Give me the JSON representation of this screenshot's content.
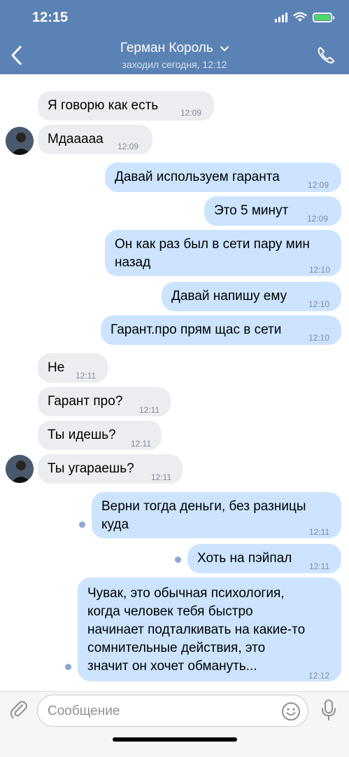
{
  "status": {
    "time": "12:15"
  },
  "header": {
    "name": "Герман Король",
    "last_seen": "заходил сегодня, 12:12"
  },
  "messages": [
    {
      "dir": "in",
      "text": "Я говорю как есть",
      "time": "12:09"
    },
    {
      "dir": "in",
      "text": "Мдааааа",
      "time": "12:09"
    },
    {
      "dir": "out",
      "text": "Давай используем гаранта",
      "time": "12:09"
    },
    {
      "dir": "out",
      "text": "Это 5 минут",
      "time": "12:09"
    },
    {
      "dir": "out",
      "text": "Он как раз был в сети пару мин\nназад",
      "time": "12:10"
    },
    {
      "dir": "out",
      "text": "Давай напишу ему",
      "time": "12:10"
    },
    {
      "dir": "out",
      "text": "Гарант.про прям щас в сети",
      "time": "12:10"
    },
    {
      "dir": "in",
      "text": "Не",
      "time": "12:11"
    },
    {
      "dir": "in",
      "text": "Гарант про?",
      "time": "12:11"
    },
    {
      "dir": "in",
      "text": "Ты идешь?",
      "time": "12:11"
    },
    {
      "dir": "in",
      "text": "Ты угараешь?",
      "time": "12:11"
    },
    {
      "dir": "out",
      "text": "Верни тогда деньги, без разницы\nкуда",
      "time": "12:11"
    },
    {
      "dir": "out",
      "text": "Хоть на пэйпал",
      "time": "12:11"
    },
    {
      "dir": "out",
      "text": "Чувак, это обычная психология,\nкогда человек тебя быстро\nначинает подталкивать на какие-то\nсомнительные действия, это\nзначит он хочет обмануть...",
      "time": "12:12"
    }
  ],
  "composer": {
    "placeholder": "Сообщение"
  },
  "icons": {
    "back": "chevron-left-icon",
    "call": "phone-icon",
    "attach": "paperclip-icon",
    "emoji": "smiley-icon",
    "mic": "microphone-icon"
  },
  "colors": {
    "header": "#5b82b4",
    "incoming": "#ebedf0",
    "outgoing": "#cce4ff",
    "battery": "#4cd964"
  }
}
